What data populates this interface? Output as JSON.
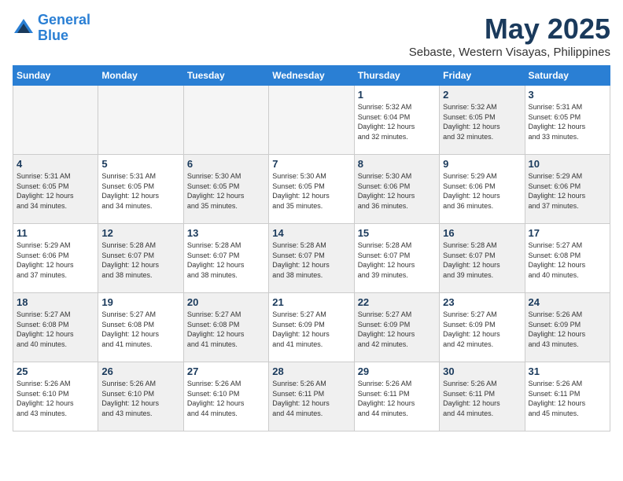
{
  "header": {
    "logo_line1": "General",
    "logo_line2": "Blue",
    "title": "May 2025",
    "subtitle": "Sebaste, Western Visayas, Philippines"
  },
  "days_of_week": [
    "Sunday",
    "Monday",
    "Tuesday",
    "Wednesday",
    "Thursday",
    "Friday",
    "Saturday"
  ],
  "weeks": [
    [
      {
        "day": "",
        "info": "",
        "empty": true
      },
      {
        "day": "",
        "info": "",
        "empty": true
      },
      {
        "day": "",
        "info": "",
        "empty": true
      },
      {
        "day": "",
        "info": "",
        "empty": true
      },
      {
        "day": "1",
        "info": "Sunrise: 5:32 AM\nSunset: 6:04 PM\nDaylight: 12 hours\nand 32 minutes.",
        "shaded": false
      },
      {
        "day": "2",
        "info": "Sunrise: 5:32 AM\nSunset: 6:05 PM\nDaylight: 12 hours\nand 32 minutes.",
        "shaded": true
      },
      {
        "day": "3",
        "info": "Sunrise: 5:31 AM\nSunset: 6:05 PM\nDaylight: 12 hours\nand 33 minutes.",
        "shaded": false
      }
    ],
    [
      {
        "day": "4",
        "info": "Sunrise: 5:31 AM\nSunset: 6:05 PM\nDaylight: 12 hours\nand 34 minutes.",
        "shaded": true
      },
      {
        "day": "5",
        "info": "Sunrise: 5:31 AM\nSunset: 6:05 PM\nDaylight: 12 hours\nand 34 minutes.",
        "shaded": false
      },
      {
        "day": "6",
        "info": "Sunrise: 5:30 AM\nSunset: 6:05 PM\nDaylight: 12 hours\nand 35 minutes.",
        "shaded": true
      },
      {
        "day": "7",
        "info": "Sunrise: 5:30 AM\nSunset: 6:05 PM\nDaylight: 12 hours\nand 35 minutes.",
        "shaded": false
      },
      {
        "day": "8",
        "info": "Sunrise: 5:30 AM\nSunset: 6:06 PM\nDaylight: 12 hours\nand 36 minutes.",
        "shaded": true
      },
      {
        "day": "9",
        "info": "Sunrise: 5:29 AM\nSunset: 6:06 PM\nDaylight: 12 hours\nand 36 minutes.",
        "shaded": false
      },
      {
        "day": "10",
        "info": "Sunrise: 5:29 AM\nSunset: 6:06 PM\nDaylight: 12 hours\nand 37 minutes.",
        "shaded": true
      }
    ],
    [
      {
        "day": "11",
        "info": "Sunrise: 5:29 AM\nSunset: 6:06 PM\nDaylight: 12 hours\nand 37 minutes.",
        "shaded": false
      },
      {
        "day": "12",
        "info": "Sunrise: 5:28 AM\nSunset: 6:07 PM\nDaylight: 12 hours\nand 38 minutes.",
        "shaded": true
      },
      {
        "day": "13",
        "info": "Sunrise: 5:28 AM\nSunset: 6:07 PM\nDaylight: 12 hours\nand 38 minutes.",
        "shaded": false
      },
      {
        "day": "14",
        "info": "Sunrise: 5:28 AM\nSunset: 6:07 PM\nDaylight: 12 hours\nand 38 minutes.",
        "shaded": true
      },
      {
        "day": "15",
        "info": "Sunrise: 5:28 AM\nSunset: 6:07 PM\nDaylight: 12 hours\nand 39 minutes.",
        "shaded": false
      },
      {
        "day": "16",
        "info": "Sunrise: 5:28 AM\nSunset: 6:07 PM\nDaylight: 12 hours\nand 39 minutes.",
        "shaded": true
      },
      {
        "day": "17",
        "info": "Sunrise: 5:27 AM\nSunset: 6:08 PM\nDaylight: 12 hours\nand 40 minutes.",
        "shaded": false
      }
    ],
    [
      {
        "day": "18",
        "info": "Sunrise: 5:27 AM\nSunset: 6:08 PM\nDaylight: 12 hours\nand 40 minutes.",
        "shaded": true
      },
      {
        "day": "19",
        "info": "Sunrise: 5:27 AM\nSunset: 6:08 PM\nDaylight: 12 hours\nand 41 minutes.",
        "shaded": false
      },
      {
        "day": "20",
        "info": "Sunrise: 5:27 AM\nSunset: 6:08 PM\nDaylight: 12 hours\nand 41 minutes.",
        "shaded": true
      },
      {
        "day": "21",
        "info": "Sunrise: 5:27 AM\nSunset: 6:09 PM\nDaylight: 12 hours\nand 41 minutes.",
        "shaded": false
      },
      {
        "day": "22",
        "info": "Sunrise: 5:27 AM\nSunset: 6:09 PM\nDaylight: 12 hours\nand 42 minutes.",
        "shaded": true
      },
      {
        "day": "23",
        "info": "Sunrise: 5:27 AM\nSunset: 6:09 PM\nDaylight: 12 hours\nand 42 minutes.",
        "shaded": false
      },
      {
        "day": "24",
        "info": "Sunrise: 5:26 AM\nSunset: 6:09 PM\nDaylight: 12 hours\nand 43 minutes.",
        "shaded": true
      }
    ],
    [
      {
        "day": "25",
        "info": "Sunrise: 5:26 AM\nSunset: 6:10 PM\nDaylight: 12 hours\nand 43 minutes.",
        "shaded": false
      },
      {
        "day": "26",
        "info": "Sunrise: 5:26 AM\nSunset: 6:10 PM\nDaylight: 12 hours\nand 43 minutes.",
        "shaded": true
      },
      {
        "day": "27",
        "info": "Sunrise: 5:26 AM\nSunset: 6:10 PM\nDaylight: 12 hours\nand 44 minutes.",
        "shaded": false
      },
      {
        "day": "28",
        "info": "Sunrise: 5:26 AM\nSunset: 6:11 PM\nDaylight: 12 hours\nand 44 minutes.",
        "shaded": true
      },
      {
        "day": "29",
        "info": "Sunrise: 5:26 AM\nSunset: 6:11 PM\nDaylight: 12 hours\nand 44 minutes.",
        "shaded": false
      },
      {
        "day": "30",
        "info": "Sunrise: 5:26 AM\nSunset: 6:11 PM\nDaylight: 12 hours\nand 44 minutes.",
        "shaded": true
      },
      {
        "day": "31",
        "info": "Sunrise: 5:26 AM\nSunset: 6:11 PM\nDaylight: 12 hours\nand 45 minutes.",
        "shaded": false
      }
    ]
  ]
}
